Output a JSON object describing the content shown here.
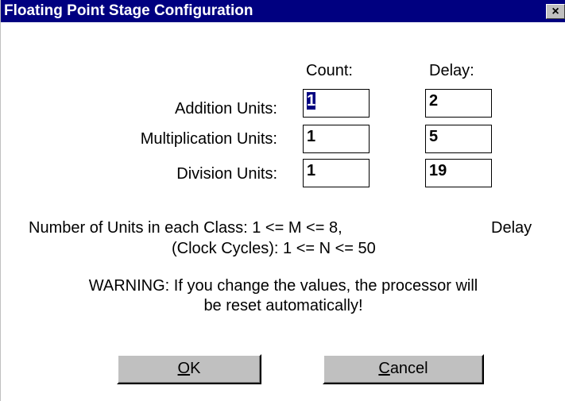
{
  "window": {
    "title": "Floating Point Stage Configuration",
    "close_glyph": "×"
  },
  "columns": {
    "count": "Count:",
    "delay": "Delay:"
  },
  "rows": [
    {
      "label": "Addition Units:",
      "count": "1",
      "delay": "2"
    },
    {
      "label": "Multiplication Units:",
      "count": "1",
      "delay": "5"
    },
    {
      "label": "Division Units:",
      "count": "1",
      "delay": "19"
    }
  ],
  "info": {
    "line1": "Number of Units in each Class: 1 <= M <= 8,",
    "line1_right": "Delay",
    "line2": "(Clock Cycles): 1 <= N <= 50"
  },
  "warning": {
    "line1": "WARNING: If you change the values, the processor will",
    "line2": "be reset automatically!"
  },
  "buttons": {
    "ok": {
      "accel": "O",
      "rest": "K"
    },
    "cancel": {
      "accel": "C",
      "rest": "ancel"
    }
  },
  "colors": {
    "titlebar": "#000080",
    "button_face": "#c0c0c0",
    "selection": "#000080"
  }
}
